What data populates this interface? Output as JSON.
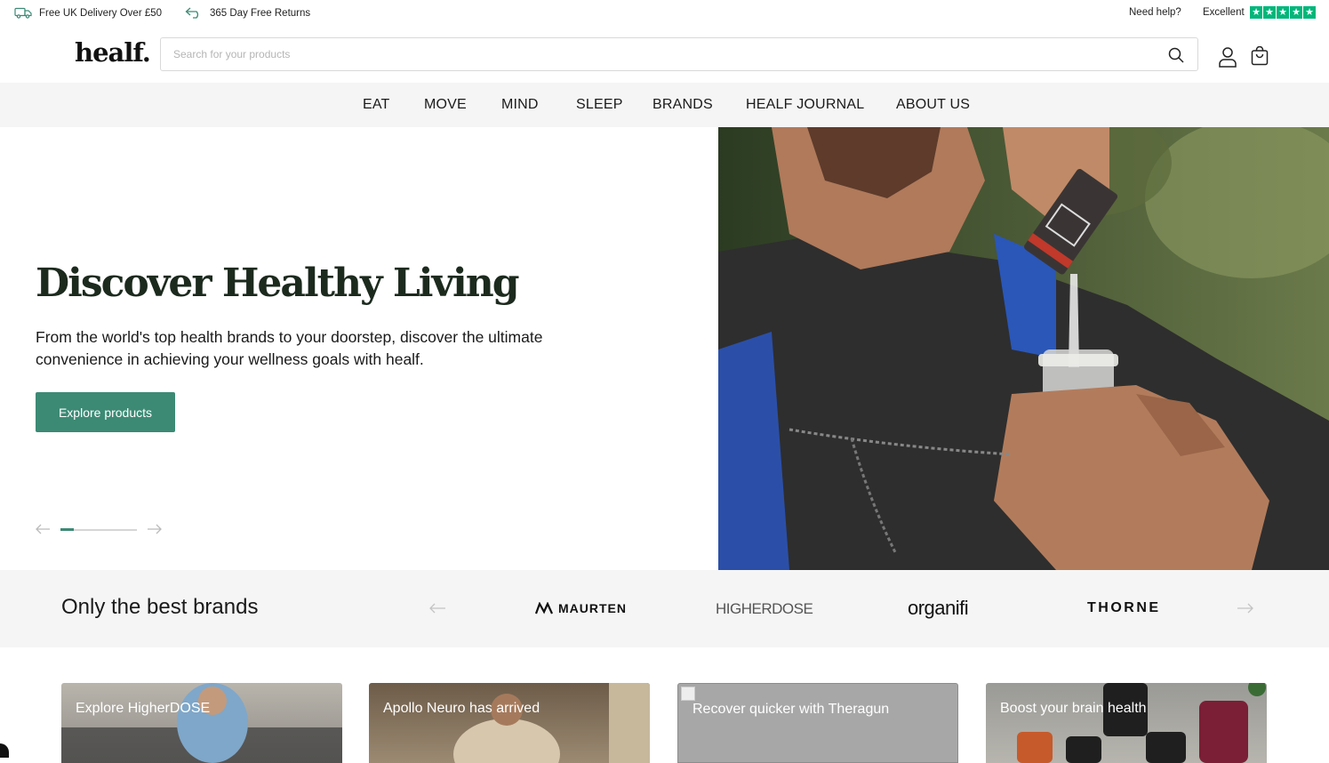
{
  "topbar": {
    "delivery": "Free UK Delivery Over £50",
    "returns": "365 Day Free Returns",
    "help": "Need help?",
    "rating_label": "Excellent",
    "rating_stars": 5,
    "rating_color": "#00b67a"
  },
  "header": {
    "logo": "healf.",
    "search_placeholder": "Search for your products"
  },
  "nav": {
    "items": [
      "EAT",
      "MOVE",
      "MIND",
      "SLEEP",
      "BRANDS",
      "HEALF JOURNAL",
      "ABOUT US"
    ]
  },
  "hero": {
    "title": "Discover Healthy Living",
    "subtitle": "From the world's top health brands to your doorstep, discover the ultimate convenience in achieving your wellness goals with healf.",
    "button": "Explore products",
    "slide_progress": 0.17,
    "accent": "#3c8a74"
  },
  "brands": {
    "title": "Only the best brands",
    "logos": [
      "MAURTEN",
      "HIGHERDOSE",
      "organifi",
      "THORNE"
    ]
  },
  "cards": [
    {
      "label": "Explore HigherDOSE"
    },
    {
      "label": "Apollo Neuro has arrived"
    },
    {
      "label": "Recover quicker with Theragun"
    },
    {
      "label": "Boost your brain health"
    }
  ]
}
